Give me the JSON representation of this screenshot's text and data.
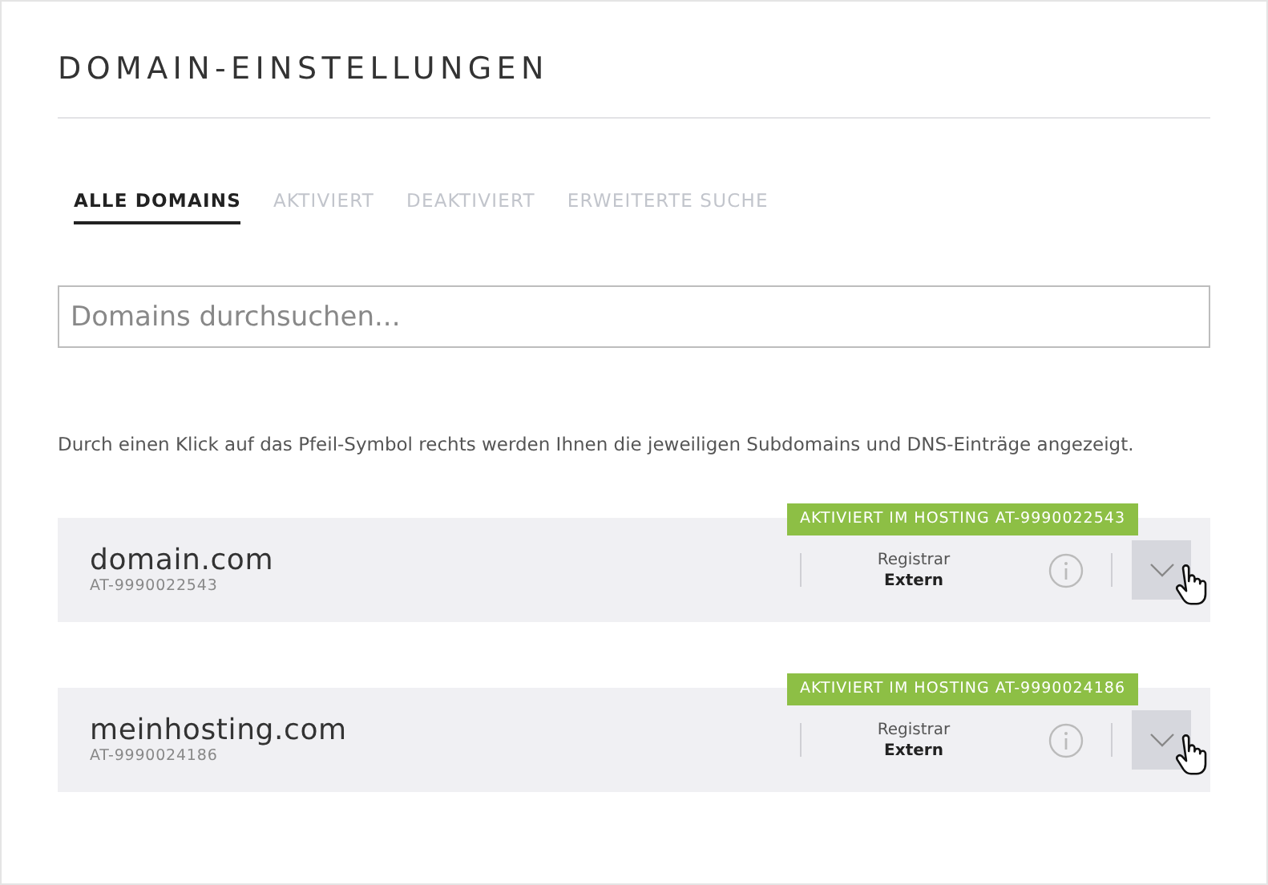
{
  "title": "DOMAIN-EINSTELLUNGEN",
  "tabs": [
    {
      "label": "ALLE DOMAINS",
      "selected": true
    },
    {
      "label": "AKTIVIERT",
      "selected": false
    },
    {
      "label": "DEAKTIVIERT",
      "selected": false
    },
    {
      "label": "ERWEITERTE SUCHE",
      "selected": false
    }
  ],
  "search": {
    "placeholder": "Domains durchsuchen..."
  },
  "hint": "Durch einen Klick auf das Pfeil-Symbol rechts werden Ihnen die jeweiligen Subdomains und DNS-Einträge angezeigt.",
  "domains": [
    {
      "name": "domain.com",
      "id": "AT-9990022543",
      "badge": "AKTIVIERT IM HOSTING AT-9990022543",
      "registrar_label": "Registrar",
      "registrar": "Extern"
    },
    {
      "name": "meinhosting.com",
      "id": "AT-9990024186",
      "badge": "AKTIVIERT IM HOSTING AT-9990024186",
      "registrar_label": "Registrar",
      "registrar": "Extern"
    }
  ]
}
